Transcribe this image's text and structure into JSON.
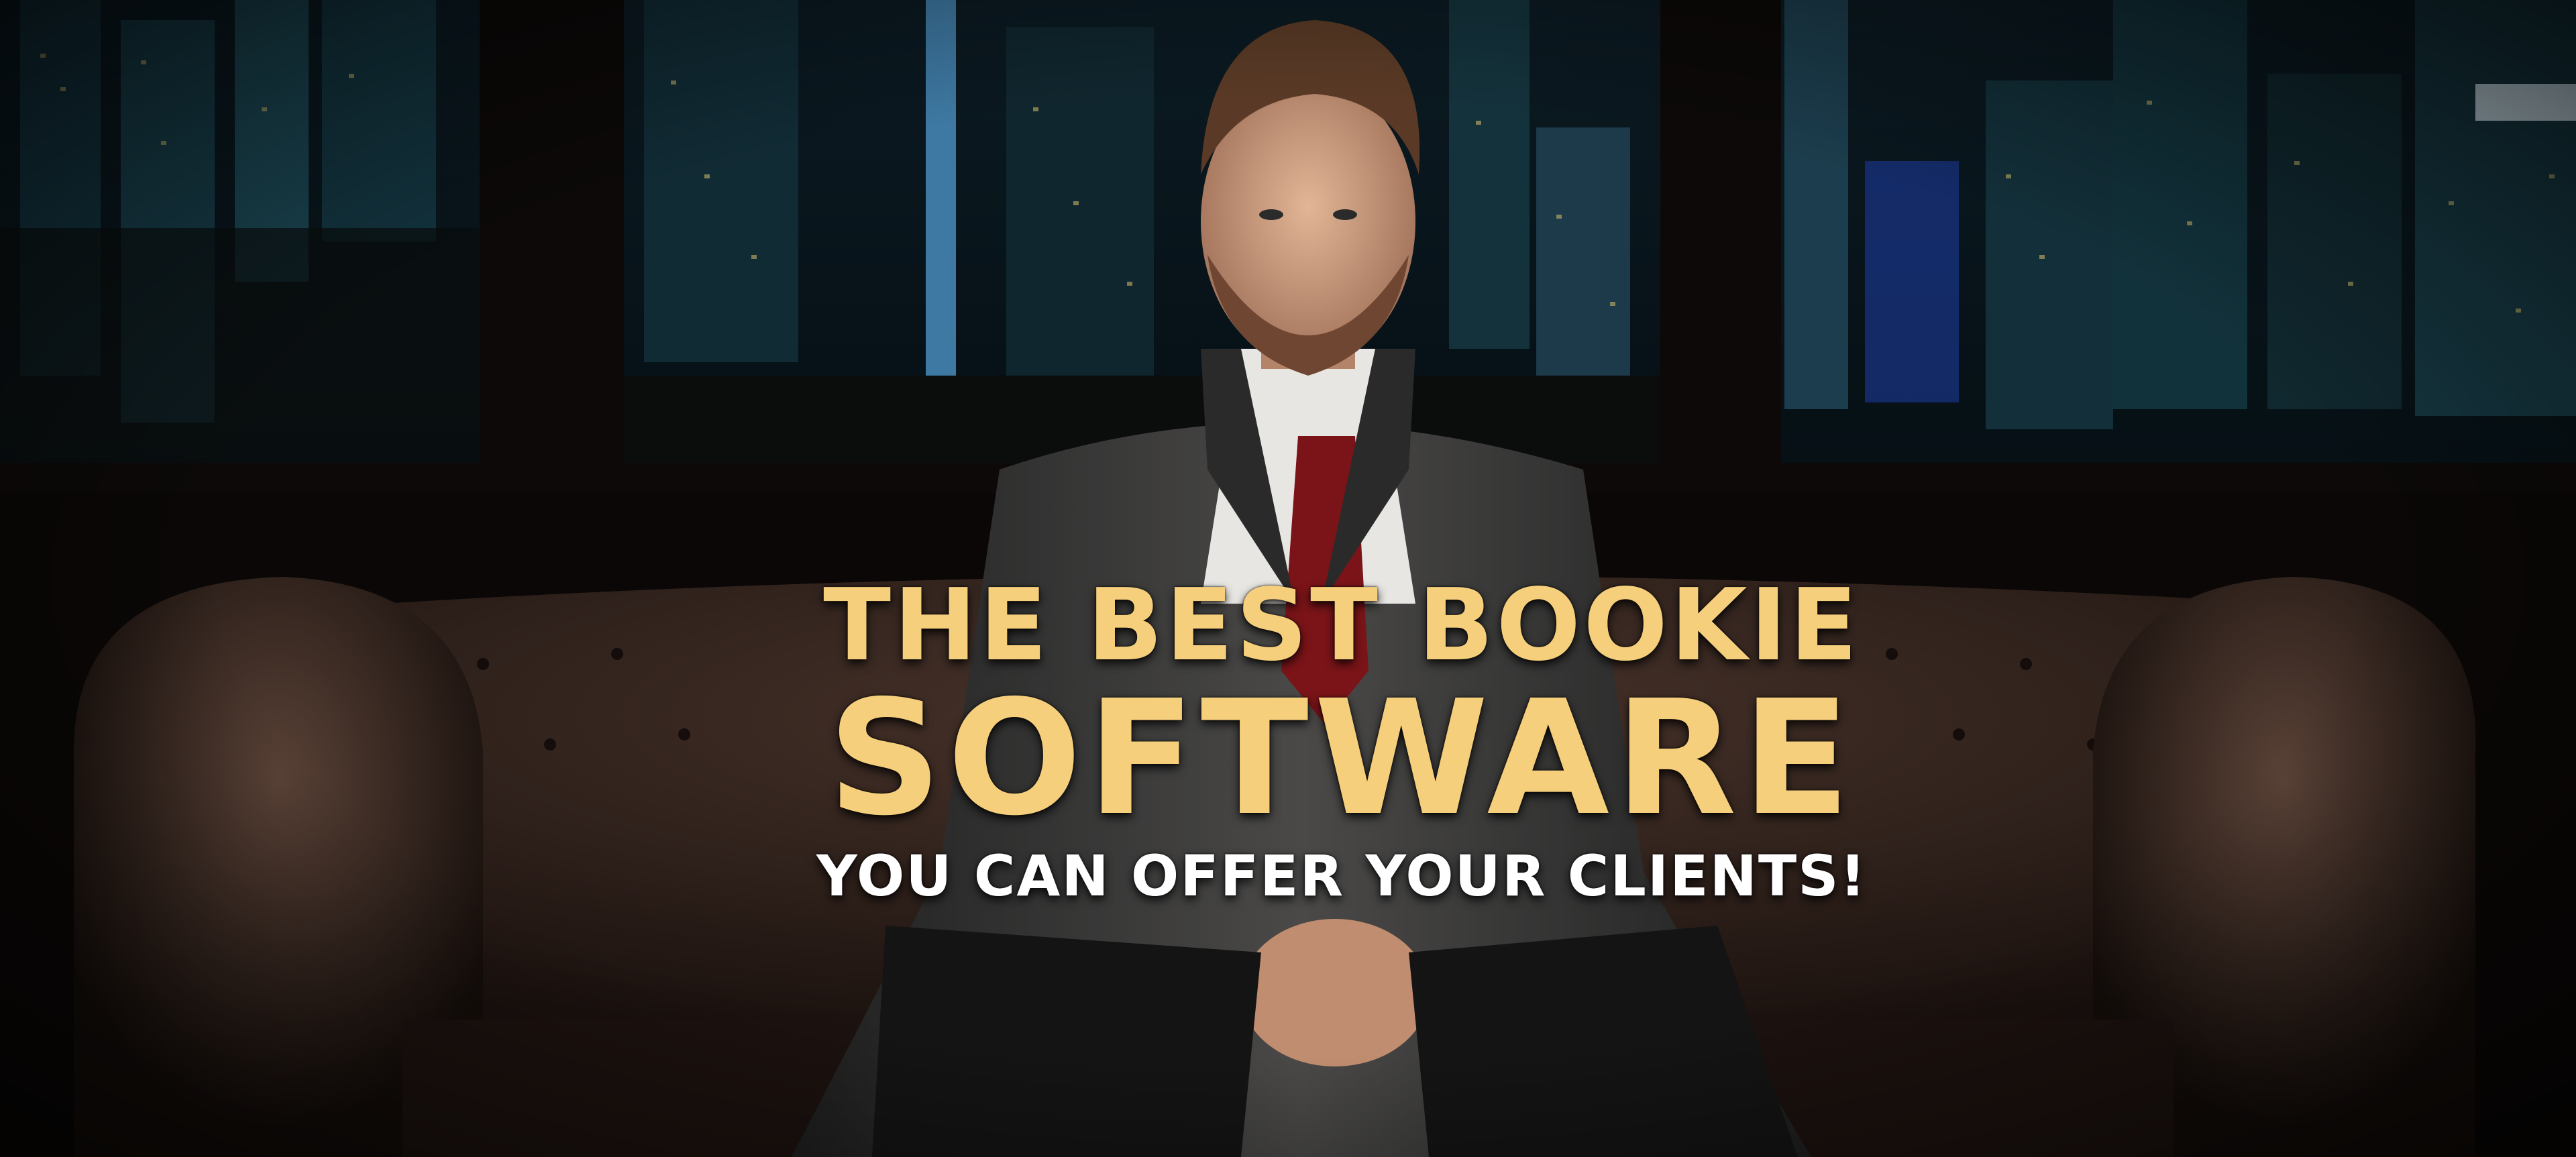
{
  "banner": {
    "headline_line1": "THE BEST BOOKIE",
    "headline_line2": "SOFTWARE",
    "headline_line3": "YOU CAN OFFER YOUR CLIENTS!"
  },
  "colors": {
    "headline_gold": "#f6cf7c",
    "headline_white": "#ffffff",
    "background": "#050404",
    "sofa_leather": "#2a1d18",
    "suit": "#3a3938",
    "tie": "#7a1418"
  }
}
